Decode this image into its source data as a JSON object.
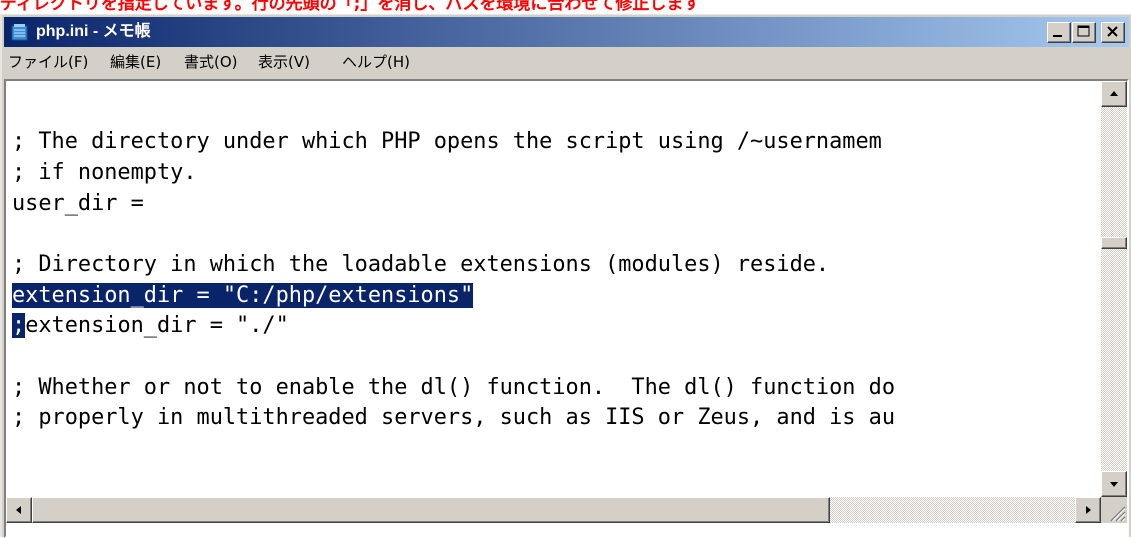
{
  "annotation_text": "ディレクトリを指定しています。行の先頭の「;」を消し、パスを環境に合わせて修正します",
  "window": {
    "title": "php.ini - メモ帳",
    "buttons": {
      "minimize": "minimize",
      "maximize": "maximize",
      "close": "close"
    }
  },
  "menu": {
    "items": [
      {
        "label": "ファイル(F)"
      },
      {
        "label": "編集(E)"
      },
      {
        "label": "書式(O)"
      },
      {
        "label": "表示(V)"
      },
      {
        "label": "ヘルプ(H)"
      }
    ]
  },
  "editor": {
    "lines": [
      "",
      "; The directory under which PHP opens the script using /~usernamem",
      "; if nonempty.",
      "user_dir =",
      "",
      "; Directory in which the loadable extensions (modules) reside.",
      "extension_dir = \"C:/php/extensions\"",
      "extension_dir = \"./\"",
      "",
      "; Whether or not to enable the dl() function.  The dl() function do",
      "; properly in multithreaded servers, such as IIS or Zeus, and is au"
    ],
    "selected_line_index": 6,
    "cursor_char": ";"
  },
  "colors": {
    "title_gradient_start": "#0a246a",
    "title_gradient_end": "#a6caf0",
    "selection": "#0a246a",
    "annotation": "#ff0000"
  },
  "icons": {
    "app": "notepad-icon",
    "scroll_up": "arrow-up-icon",
    "scroll_down": "arrow-down-icon",
    "scroll_left": "arrow-left-icon",
    "scroll_right": "arrow-right-icon",
    "grip": "resize-grip-icon"
  }
}
